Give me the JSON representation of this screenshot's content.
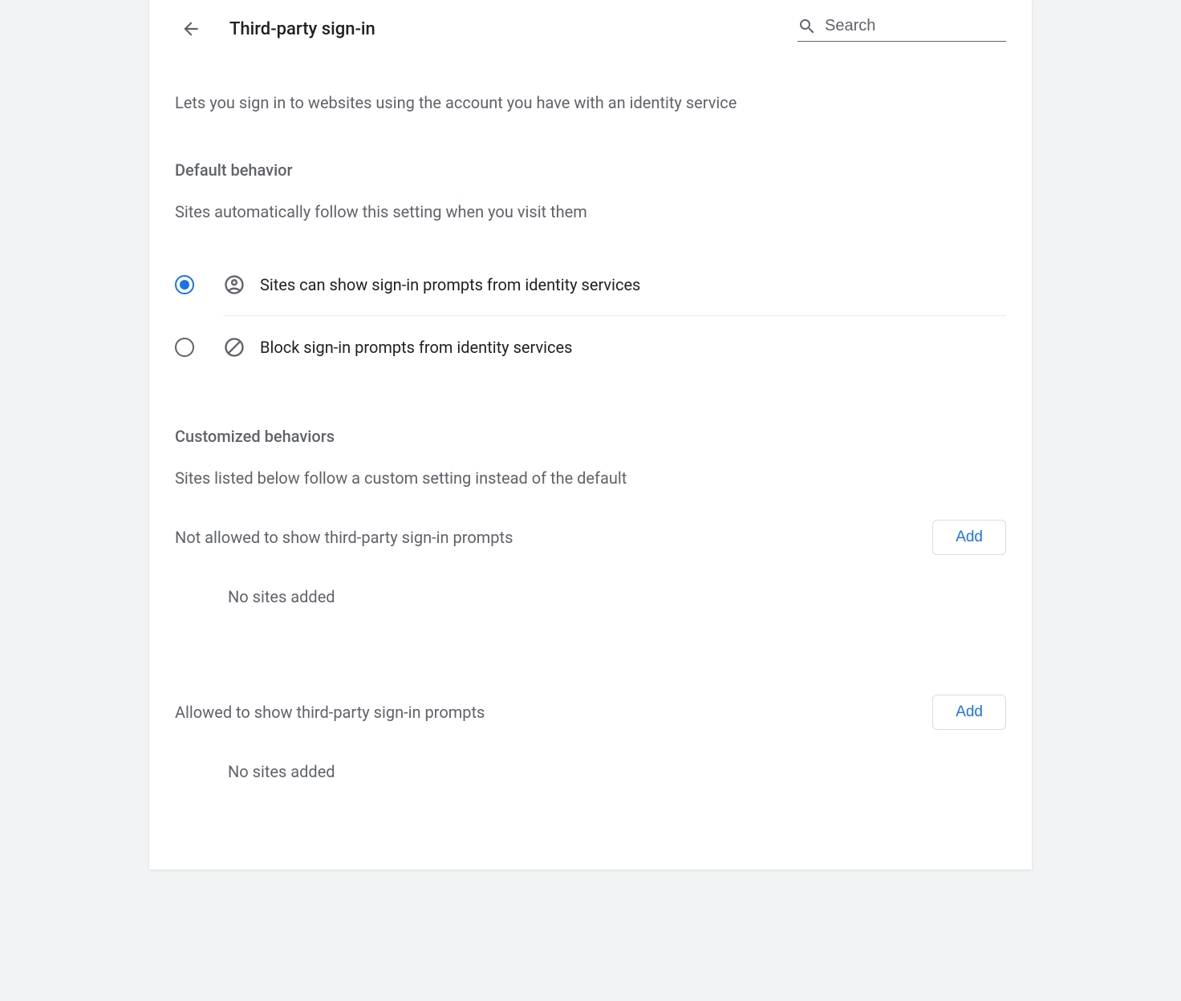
{
  "header": {
    "title": "Third-party sign-in",
    "search_placeholder": "Search"
  },
  "description": "Lets you sign in to websites using the account you have with an identity service",
  "default_behavior": {
    "heading": "Default behavior",
    "subtext": "Sites automatically follow this setting when you visit them",
    "options": [
      {
        "label": "Sites can show sign-in prompts from identity services",
        "selected": true
      },
      {
        "label": "Block sign-in prompts from identity services",
        "selected": false
      }
    ]
  },
  "customized": {
    "heading": "Customized behaviors",
    "subtext": "Sites listed below follow a custom setting instead of the default",
    "not_allowed": {
      "title": "Not allowed to show third-party sign-in prompts",
      "add_label": "Add",
      "empty": "No sites added"
    },
    "allowed": {
      "title": "Allowed to show third-party sign-in prompts",
      "add_label": "Add",
      "empty": "No sites added"
    }
  }
}
